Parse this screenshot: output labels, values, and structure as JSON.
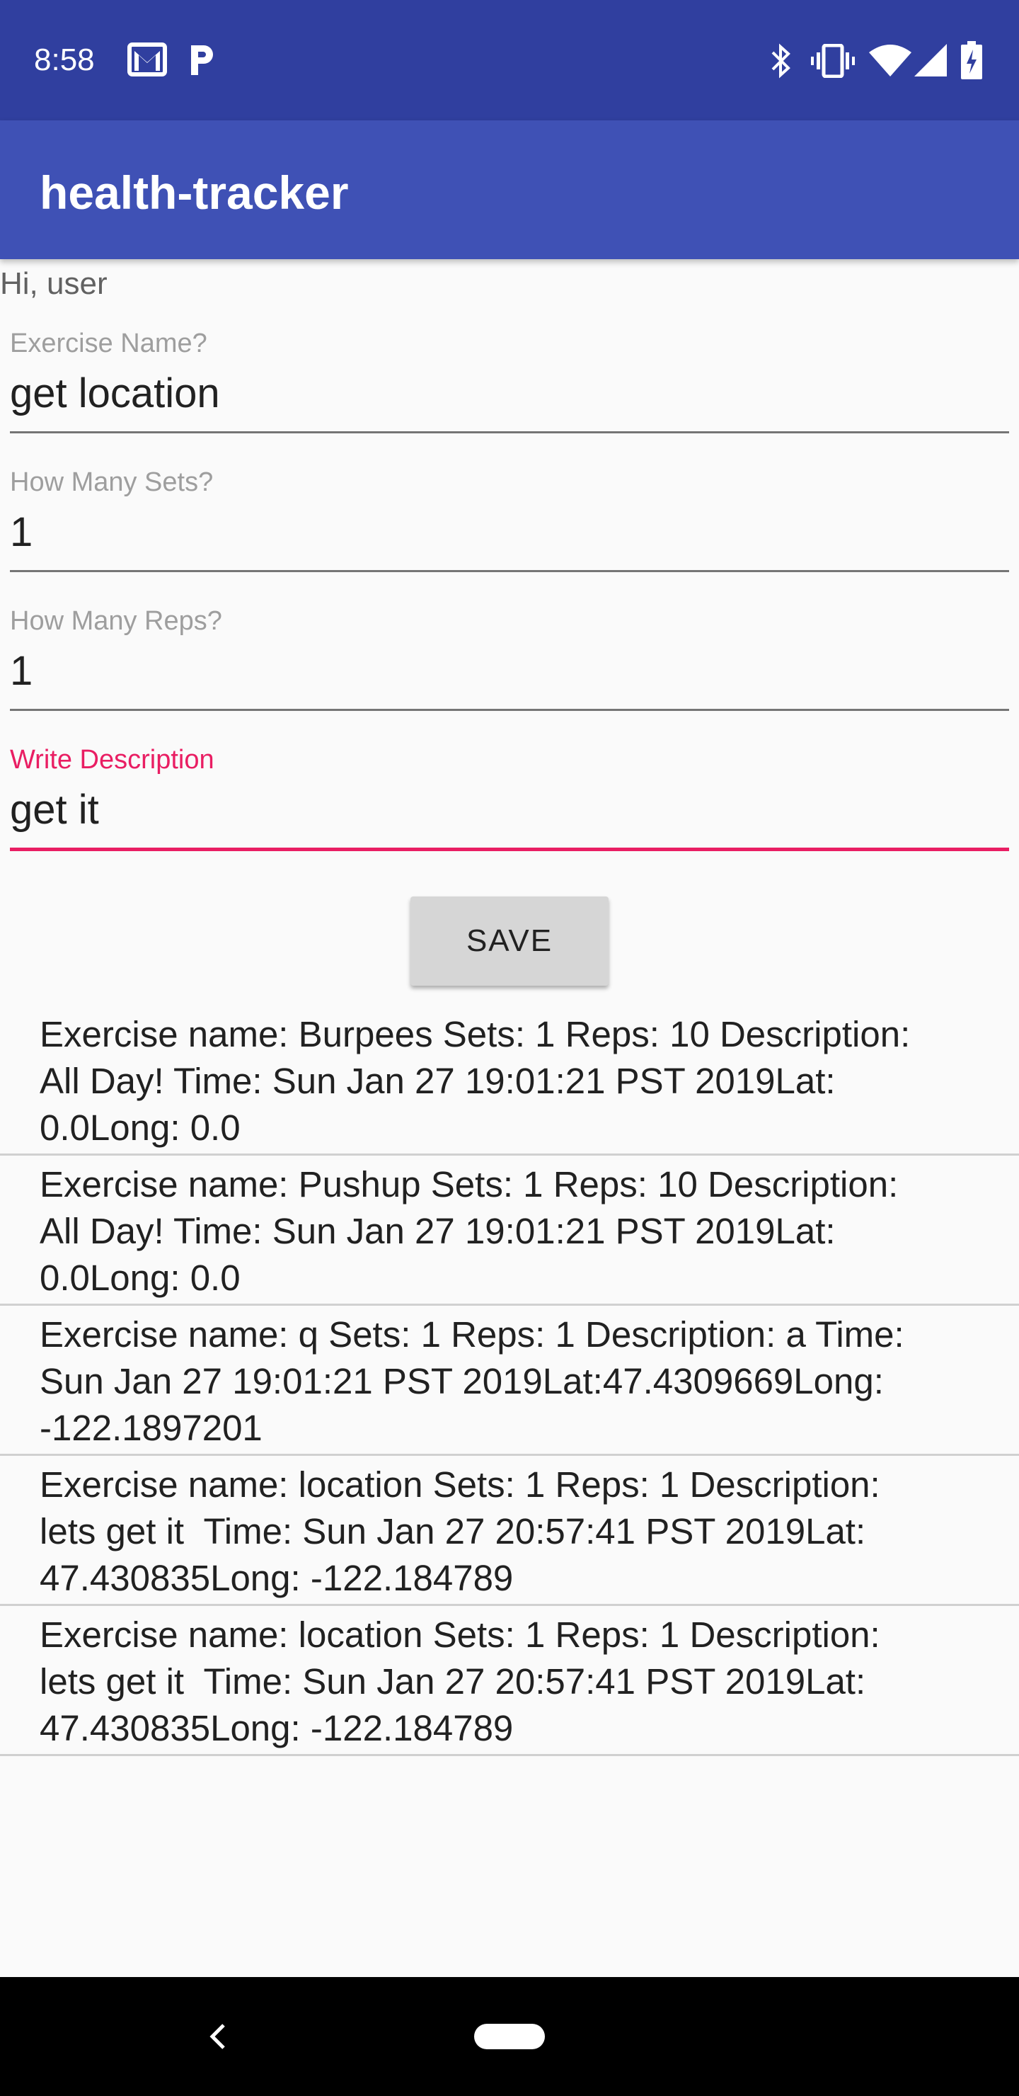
{
  "status_bar": {
    "time": "8:58",
    "left_icons": [
      "gmail-icon",
      "parking-p-icon"
    ],
    "right_icons": [
      "bluetooth-icon",
      "vibrate-icon",
      "wifi-icon",
      "cell-signal-icon",
      "battery-charging-icon"
    ]
  },
  "app_bar": {
    "title": "health-tracker"
  },
  "greeting": "Hi, user",
  "form": {
    "exercise_name": {
      "label": "Exercise Name?",
      "value": "get location"
    },
    "sets": {
      "label": "How Many Sets?",
      "value": "1"
    },
    "reps": {
      "label": "How Many Reps?",
      "value": "1"
    },
    "description": {
      "label": "Write Description",
      "value": "get it"
    },
    "save_label": "SAVE"
  },
  "log_entries": [
    "Exercise name: Burpees Sets: 1 Reps: 10 Description:\nAll Day! Time: Sun Jan 27 19:01:21 PST 2019Lat:\n0.0Long: 0.0",
    "Exercise name: Pushup Sets: 1 Reps: 10 Description:\nAll Day! Time: Sun Jan 27 19:01:21 PST 2019Lat:\n0.0Long: 0.0",
    "Exercise name: q Sets: 1 Reps: 1 Description: a Time:\nSun Jan 27 19:01:21 PST 2019Lat:47.4309669Long:\n-122.1897201",
    "Exercise name: location Sets: 1 Reps: 1 Description:\nlets get it  Time: Sun Jan 27 20:57:41 PST 2019Lat:\n47.430835Long: -122.184789",
    "Exercise name: location Sets: 1 Reps: 1 Description:\nlets get it  Time: Sun Jan 27 20:57:41 PST 2019Lat:\n47.430835Long: -122.184789"
  ],
  "nav_bar": {
    "icons": [
      "back-icon",
      "home-pill-icon"
    ]
  },
  "colors": {
    "status_bar": "#303f9f",
    "app_bar": "#3f51b5",
    "accent": "#e91e63",
    "background": "#fafafa"
  }
}
